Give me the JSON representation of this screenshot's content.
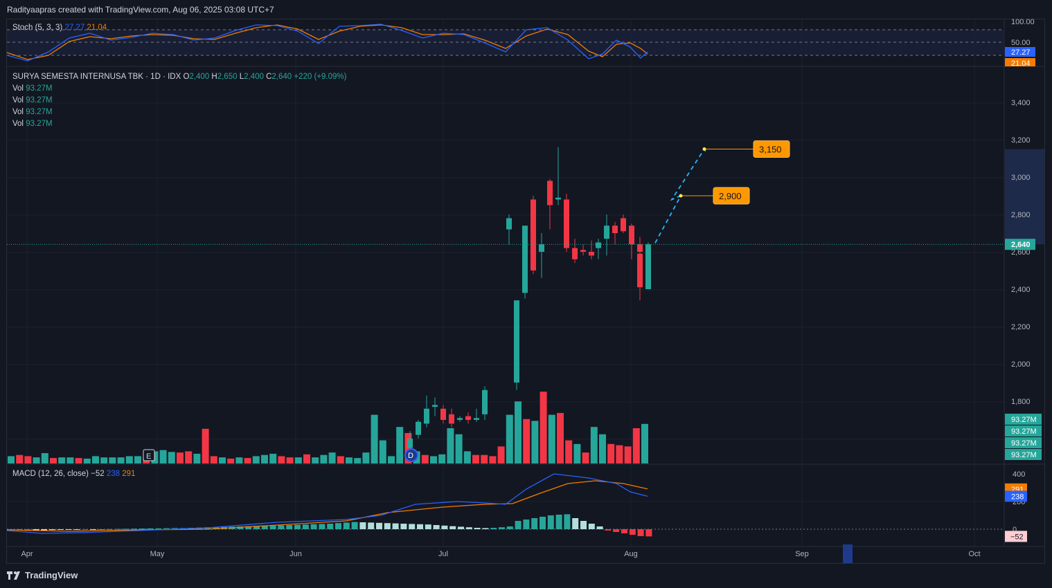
{
  "header": {
    "text": "Radityaapras created with TradingView.com, Aug 06, 2025 03:08 UTC+7"
  },
  "footer": {
    "brand": "TradingView"
  },
  "colors": {
    "up": "#26a69a",
    "down": "#f23645",
    "stoch_k": "#2962ff",
    "stoch_d": "#f57c00",
    "target": "#ff9800",
    "path": "#29b6f6",
    "bg": "#131722"
  },
  "symbol_legend": {
    "name": "SURYA SEMESTA INTERNUSA TBK · 1D · IDX",
    "o_label": "O",
    "o": "2,400",
    "h_label": "H",
    "h": "2,650",
    "l_label": "L",
    "l": "2,400",
    "c_label": "C",
    "c": "2,640",
    "change": "+220 (+9.09%)",
    "vol_label": "Vol",
    "vol": "93.27M"
  },
  "stoch_legend": {
    "name": "Stoch (5, 3, 3)",
    "k": "27.27",
    "d": "21.04"
  },
  "macd_legend": {
    "name": "MACD (12, 26, close)",
    "hist": "−52",
    "macd": "238",
    "signal": "291"
  },
  "markers": {
    "earnings": "E",
    "dividend": "D"
  },
  "chart_data": {
    "type": "candlestick",
    "price_axis": {
      "ticks": [
        "3,400",
        "3,200",
        "3,000",
        "2,800",
        "2,600",
        "2,400",
        "2,200",
        "2,000",
        "1,800"
      ],
      "ylim": [
        1470,
        3450
      ]
    },
    "time_axis": {
      "labels": [
        "Apr",
        "May",
        "Jun",
        "Jul",
        "Aug",
        "Sep",
        "Oct"
      ]
    },
    "last_price": "2,640",
    "volume_labels": [
      "93.27M",
      "93.27M",
      "93.27M",
      "93.27M"
    ],
    "targets": [
      {
        "label": "2,900",
        "value": 2900
      },
      {
        "label": "3,150",
        "value": 3150
      }
    ],
    "candles": [
      {
        "o": 2720,
        "h": 2800,
        "l": 2640,
        "c": 2780
      },
      {
        "o": 2380,
        "h": 2480,
        "l": 2350,
        "c": 2740
      },
      {
        "o": 2880,
        "h": 2900,
        "l": 2480,
        "c": 2500
      },
      {
        "o": 2600,
        "h": 2700,
        "l": 2460,
        "c": 2640
      },
      {
        "o": 2980,
        "h": 2990,
        "l": 2720,
        "c": 2850
      },
      {
        "o": 2880,
        "h": 3160,
        "l": 2850,
        "c": 2890
      },
      {
        "o": 2880,
        "h": 2910,
        "l": 2600,
        "c": 2620
      },
      {
        "o": 2620,
        "h": 2670,
        "l": 2540,
        "c": 2560
      },
      {
        "o": 2610,
        "h": 2640,
        "l": 2580,
        "c": 2600
      },
      {
        "o": 2600,
        "h": 2660,
        "l": 2560,
        "c": 2580
      },
      {
        "o": 2620,
        "h": 2670,
        "l": 2560,
        "c": 2650
      },
      {
        "o": 2670,
        "h": 2800,
        "l": 2580,
        "c": 2740
      },
      {
        "o": 2740,
        "h": 2760,
        "l": 2640,
        "c": 2700
      },
      {
        "o": 2780,
        "h": 2800,
        "l": 2700,
        "c": 2710
      },
      {
        "o": 2740,
        "h": 2750,
        "l": 2560,
        "c": 2640
      },
      {
        "o": 2640,
        "h": 2680,
        "l": 2560,
        "c": 2600
      },
      {
        "o": 2590,
        "h": 2600,
        "l": 2340,
        "c": 2410
      },
      {
        "o": 2400,
        "h": 2650,
        "l": 2400,
        "c": 2640
      }
    ],
    "early_candles": [
      {
        "o": 1550,
        "h": 1640,
        "l": 1540,
        "c": 1600
      },
      {
        "o": 1620,
        "h": 1700,
        "l": 1600,
        "c": 1690
      },
      {
        "o": 1680,
        "h": 1830,
        "l": 1660,
        "c": 1760
      },
      {
        "o": 1770,
        "h": 1820,
        "l": 1720,
        "c": 1780
      },
      {
        "o": 1760,
        "h": 1780,
        "l": 1680,
        "c": 1700
      },
      {
        "o": 1730,
        "h": 1760,
        "l": 1660,
        "c": 1680
      },
      {
        "o": 1700,
        "h": 1720,
        "l": 1690,
        "c": 1710
      },
      {
        "o": 1720,
        "h": 1740,
        "l": 1680,
        "c": 1700
      },
      {
        "o": 1700,
        "h": 1760,
        "l": 1690,
        "c": 1710
      },
      {
        "o": 1730,
        "h": 1880,
        "l": 1700,
        "c": 1860
      },
      {
        "o": 1900,
        "h": 2340,
        "l": 1860,
        "c": 2340
      }
    ],
    "volume": [
      {
        "v": 12,
        "up": true
      },
      {
        "v": 14,
        "up": false
      },
      {
        "v": 12,
        "up": false
      },
      {
        "v": 10,
        "up": true
      },
      {
        "v": 17,
        "up": true
      },
      {
        "v": 9,
        "up": false
      },
      {
        "v": 10,
        "up": true
      },
      {
        "v": 10,
        "up": true
      },
      {
        "v": 9,
        "up": false
      },
      {
        "v": 8,
        "up": true
      },
      {
        "v": 12,
        "up": true
      },
      {
        "v": 10,
        "up": true
      },
      {
        "v": 10,
        "up": true
      },
      {
        "v": 10,
        "up": true
      },
      {
        "v": 12,
        "up": true
      },
      {
        "v": 12,
        "up": true
      },
      {
        "v": 10,
        "up": false
      },
      {
        "v": 20,
        "up": true
      },
      {
        "v": 22,
        "up": true
      },
      {
        "v": 19,
        "up": true
      },
      {
        "v": 18,
        "up": false
      },
      {
        "v": 20,
        "up": false
      },
      {
        "v": 16,
        "up": true
      },
      {
        "v": 57,
        "up": false
      },
      {
        "v": 12,
        "up": false
      },
      {
        "v": 10,
        "up": true
      },
      {
        "v": 8,
        "up": false
      },
      {
        "v": 10,
        "up": true
      },
      {
        "v": 9,
        "up": false
      },
      {
        "v": 12,
        "up": true
      },
      {
        "v": 14,
        "up": true
      },
      {
        "v": 16,
        "up": true
      },
      {
        "v": 12,
        "up": false
      },
      {
        "v": 10,
        "up": false
      },
      {
        "v": 10,
        "up": true
      },
      {
        "v": 15,
        "up": false
      },
      {
        "v": 10,
        "up": true
      },
      {
        "v": 14,
        "up": true
      },
      {
        "v": 18,
        "up": true
      },
      {
        "v": 12,
        "up": false
      },
      {
        "v": 10,
        "up": true
      },
      {
        "v": 9,
        "up": true
      },
      {
        "v": 18,
        "up": true
      },
      {
        "v": 80,
        "up": true
      },
      {
        "v": 38,
        "up": true
      },
      {
        "v": 12,
        "up": true
      },
      {
        "v": 60,
        "up": true
      },
      {
        "v": 50,
        "up": false
      },
      {
        "v": 20,
        "up": true
      },
      {
        "v": 14,
        "up": false
      },
      {
        "v": 12,
        "up": true
      },
      {
        "v": 15,
        "up": true
      },
      {
        "v": 58,
        "up": true
      },
      {
        "v": 48,
        "up": true
      },
      {
        "v": 20,
        "up": true
      },
      {
        "v": 14,
        "up": false
      },
      {
        "v": 14,
        "up": false
      },
      {
        "v": 12,
        "up": false
      },
      {
        "v": 28,
        "up": false
      },
      {
        "v": 80,
        "up": true
      },
      {
        "v": 102,
        "up": true
      },
      {
        "v": 73,
        "up": false
      },
      {
        "v": 70,
        "up": true
      },
      {
        "v": 118,
        "up": false
      },
      {
        "v": 80,
        "up": true
      },
      {
        "v": 83,
        "up": false
      },
      {
        "v": 38,
        "up": false
      },
      {
        "v": 32,
        "up": true
      },
      {
        "v": 18,
        "up": false
      },
      {
        "v": 60,
        "up": true
      },
      {
        "v": 48,
        "up": true
      },
      {
        "v": 32,
        "up": false
      },
      {
        "v": 30,
        "up": false
      },
      {
        "v": 28,
        "up": false
      },
      {
        "v": 58,
        "up": false
      },
      {
        "v": 65,
        "up": true
      }
    ],
    "stoch_axis": [
      "100.00",
      "50.00"
    ],
    "stoch_last": {
      "k": "27.27",
      "d": "21.04"
    },
    "macd_axis": [
      "400",
      "200",
      "0"
    ],
    "macd_last": {
      "macd": "238",
      "signal": "291",
      "hist": "−52"
    }
  }
}
